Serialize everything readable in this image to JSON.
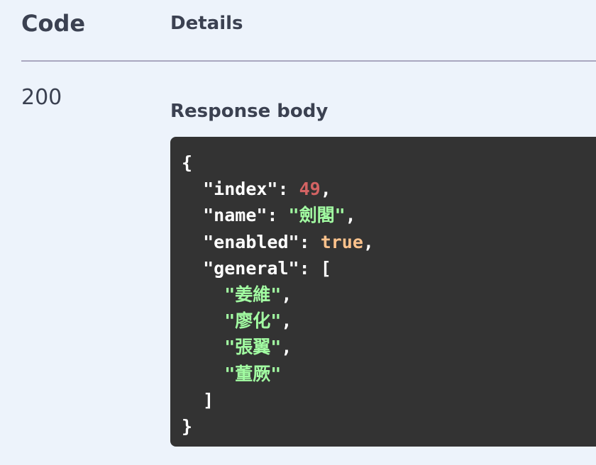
{
  "table": {
    "code_header": "Code",
    "details_header": "Details"
  },
  "response": {
    "status_code": "200",
    "body_label": "Response body",
    "json": {
      "open_brace": "{",
      "index_key": "\"index\"",
      "index_value": "49",
      "name_key": "\"name\"",
      "name_value": "\"劍閣\"",
      "enabled_key": "\"enabled\"",
      "enabled_value": "true",
      "general_key": "\"general\"",
      "open_bracket": "[",
      "generals": [
        "\"姜維\"",
        "\"廖化\"",
        "\"張翼\"",
        "\"董厥\""
      ],
      "close_bracket": "]",
      "close_brace": "}"
    }
  }
}
